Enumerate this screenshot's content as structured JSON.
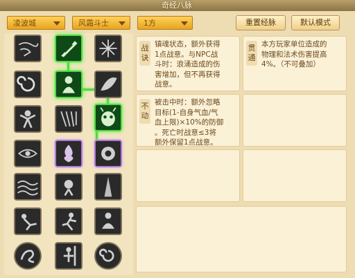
{
  "window": {
    "title": "奇经八脉"
  },
  "toolbar": {
    "dropdown1": "凌波城",
    "dropdown2": "风霜斗士",
    "dropdown3": "1方",
    "reset_label": "重置经脉",
    "default_label": "默认模式"
  },
  "skills_grid": {
    "icons": [
      "storm-icon",
      "feather-banner-icon",
      "starburst-icon",
      "swirl-icon",
      "silhouette-icon",
      "leaf-wind-icon",
      "warrior-icon",
      "claws-icon",
      "demon-mask-icon",
      "eye-scroll-icon",
      "flame-spirit-icon",
      "dark-spirit-icon",
      "waves-icon",
      "sun-figure-icon",
      "spear-figure-icon",
      "falling-figure-icon",
      "running-figure-icon",
      "meditating-figure-icon",
      "round-dragon-icon",
      "staff-figure-icon",
      "round-coil-icon"
    ]
  },
  "cards": [
    {
      "tag": "战诀",
      "text": "镇魂状态，额外获得\n1点战意。与NPC战\n斗时：浪涌造成的伤\n害增加，但不再获得\n战意。"
    },
    {
      "tag": "贯通",
      "text": "本方玩家单位造成的\n物理和法术伤害提高\n4%。（不可叠加）"
    },
    {
      "tag": "不动",
      "text": "被击中时：额外忽略\n目标(1-自身气血/气\n血上限)×10%的防御\n。死亡时战意≤3将\n额外保留1点战意。"
    }
  ],
  "colors": {
    "accent_green": "#5bd34a",
    "dropdown_gold": "#e6a420",
    "text_brown": "#6b4b1f"
  }
}
